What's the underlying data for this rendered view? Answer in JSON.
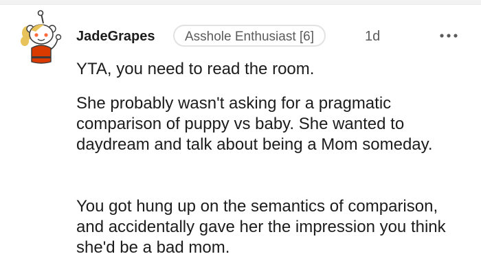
{
  "comment": {
    "username": "JadeGrapes",
    "flair": "Asshole Enthusiast [6]",
    "timestamp": "1d",
    "paragraphs": [
      "YTA, you need to read the room.",
      "She probably wasn't asking for a pragmatic comparison of puppy vs baby. She wanted to daydream and talk about being a Mom someday.",
      "You got hung up on the semantics of comparison, and accidentally gave her the impression you think she'd be a bad mom."
    ]
  },
  "icons": {
    "avatar": "reddit-snoo-avatar-icon",
    "more": "more-options-icon"
  },
  "colors": {
    "text": "#1c1c1c",
    "meta": "#5b5b5b",
    "flair_border": "#e2e2e2",
    "avatar_shirt": "#d93a00"
  }
}
